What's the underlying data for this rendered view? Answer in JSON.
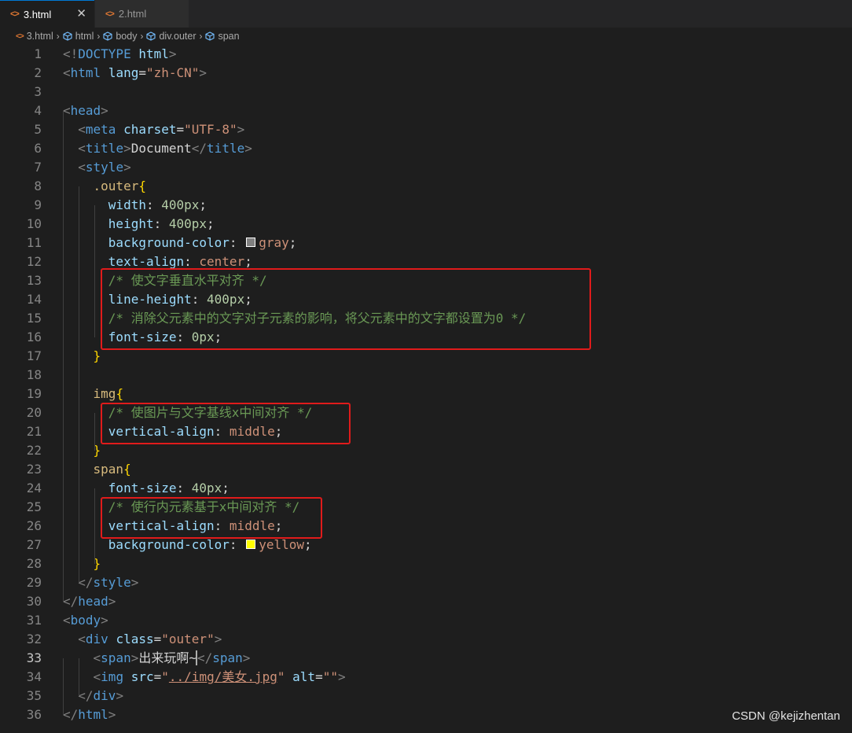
{
  "tabs": [
    {
      "label": "3.html",
      "icon": "html-code-icon",
      "active": true,
      "close": "✕"
    },
    {
      "label": "2.html",
      "icon": "html-code-icon",
      "active": false
    }
  ],
  "breadcrumbs": [
    "3.html",
    "html",
    "body",
    "div.outer",
    "span"
  ],
  "colors": {
    "gray_swatch": "#808080",
    "yellow_swatch": "#ffff00"
  },
  "lines": [
    {
      "n": "1",
      "tokens": [
        {
          "c": "t-br",
          "t": "<!"
        },
        {
          "c": "t-tag",
          "t": "DOCTYPE"
        },
        {
          "c": "t-txt",
          "t": " "
        },
        {
          "c": "t-attr",
          "t": "html"
        },
        {
          "c": "t-br",
          "t": ">"
        }
      ]
    },
    {
      "n": "2",
      "tokens": [
        {
          "c": "t-br",
          "t": "<"
        },
        {
          "c": "t-tag",
          "t": "html"
        },
        {
          "c": "t-txt",
          "t": " "
        },
        {
          "c": "t-attr",
          "t": "lang"
        },
        {
          "c": "t-txt",
          "t": "="
        },
        {
          "c": "t-str",
          "t": "\"zh-CN\""
        },
        {
          "c": "t-br",
          "t": ">"
        }
      ]
    },
    {
      "n": "3",
      "tokens": []
    },
    {
      "n": "4",
      "tokens": [
        {
          "c": "t-br",
          "t": "<"
        },
        {
          "c": "t-tag",
          "t": "head"
        },
        {
          "c": "t-br",
          "t": ">"
        }
      ]
    },
    {
      "n": "5",
      "tokens": [
        {
          "c": "t-txt",
          "t": "  "
        },
        {
          "c": "t-br",
          "t": "<"
        },
        {
          "c": "t-tag",
          "t": "meta"
        },
        {
          "c": "t-txt",
          "t": " "
        },
        {
          "c": "t-attr",
          "t": "charset"
        },
        {
          "c": "t-txt",
          "t": "="
        },
        {
          "c": "t-str",
          "t": "\"UTF-8\""
        },
        {
          "c": "t-br",
          "t": ">"
        }
      ]
    },
    {
      "n": "6",
      "tokens": [
        {
          "c": "t-txt",
          "t": "  "
        },
        {
          "c": "t-br",
          "t": "<"
        },
        {
          "c": "t-tag",
          "t": "title"
        },
        {
          "c": "t-br",
          "t": ">"
        },
        {
          "c": "t-txt",
          "t": "Document"
        },
        {
          "c": "t-br",
          "t": "</"
        },
        {
          "c": "t-tag",
          "t": "title"
        },
        {
          "c": "t-br",
          "t": ">"
        }
      ]
    },
    {
      "n": "7",
      "tokens": [
        {
          "c": "t-txt",
          "t": "  "
        },
        {
          "c": "t-br",
          "t": "<"
        },
        {
          "c": "t-tag",
          "t": "style"
        },
        {
          "c": "t-br",
          "t": ">"
        }
      ]
    },
    {
      "n": "8",
      "tokens": [
        {
          "c": "t-txt",
          "t": "    "
        },
        {
          "c": "t-sel",
          "t": ".outer"
        },
        {
          "c": "t-brace",
          "t": "{"
        }
      ]
    },
    {
      "n": "9",
      "tokens": [
        {
          "c": "t-txt",
          "t": "      "
        },
        {
          "c": "t-prop",
          "t": "width"
        },
        {
          "c": "t-txt",
          "t": ": "
        },
        {
          "c": "t-num",
          "t": "400px"
        },
        {
          "c": "t-txt",
          "t": ";"
        }
      ]
    },
    {
      "n": "10",
      "tokens": [
        {
          "c": "t-txt",
          "t": "      "
        },
        {
          "c": "t-prop",
          "t": "height"
        },
        {
          "c": "t-txt",
          "t": ": "
        },
        {
          "c": "t-num",
          "t": "400px"
        },
        {
          "c": "t-txt",
          "t": ";"
        }
      ]
    },
    {
      "n": "11",
      "tokens": [
        {
          "c": "t-txt",
          "t": "      "
        },
        {
          "c": "t-prop",
          "t": "background-color"
        },
        {
          "c": "t-txt",
          "t": ": "
        },
        {
          "swatch": "gray_swatch"
        },
        {
          "c": "t-val",
          "t": "gray"
        },
        {
          "c": "t-txt",
          "t": ";"
        }
      ]
    },
    {
      "n": "12",
      "tokens": [
        {
          "c": "t-txt",
          "t": "      "
        },
        {
          "c": "t-prop",
          "t": "text-align"
        },
        {
          "c": "t-txt",
          "t": ": "
        },
        {
          "c": "t-val",
          "t": "center"
        },
        {
          "c": "t-txt",
          "t": ";"
        }
      ]
    },
    {
      "n": "13",
      "tokens": [
        {
          "c": "t-txt",
          "t": "      "
        },
        {
          "c": "t-com",
          "t": "/* 使文字垂直水平对齐 */"
        }
      ]
    },
    {
      "n": "14",
      "tokens": [
        {
          "c": "t-txt",
          "t": "      "
        },
        {
          "c": "t-prop",
          "t": "line-height"
        },
        {
          "c": "t-txt",
          "t": ": "
        },
        {
          "c": "t-num",
          "t": "400px"
        },
        {
          "c": "t-txt",
          "t": ";"
        }
      ]
    },
    {
      "n": "15",
      "tokens": [
        {
          "c": "t-txt",
          "t": "      "
        },
        {
          "c": "t-com",
          "t": "/* 消除父元素中的文字对子元素的影响，将父元素中的文字都设置为0 */"
        }
      ]
    },
    {
      "n": "16",
      "tokens": [
        {
          "c": "t-txt",
          "t": "      "
        },
        {
          "c": "t-prop",
          "t": "font-size"
        },
        {
          "c": "t-txt",
          "t": ": "
        },
        {
          "c": "t-num",
          "t": "0px"
        },
        {
          "c": "t-txt",
          "t": ";"
        }
      ]
    },
    {
      "n": "17",
      "tokens": [
        {
          "c": "t-txt",
          "t": "    "
        },
        {
          "c": "t-brace",
          "t": "}"
        }
      ]
    },
    {
      "n": "18",
      "tokens": []
    },
    {
      "n": "19",
      "tokens": [
        {
          "c": "t-txt",
          "t": "    "
        },
        {
          "c": "t-sel",
          "t": "img"
        },
        {
          "c": "t-brace",
          "t": "{"
        }
      ]
    },
    {
      "n": "20",
      "tokens": [
        {
          "c": "t-txt",
          "t": "      "
        },
        {
          "c": "t-com",
          "t": "/* 使图片与文字基线x中间对齐 */"
        }
      ]
    },
    {
      "n": "21",
      "tokens": [
        {
          "c": "t-txt",
          "t": "      "
        },
        {
          "c": "t-prop",
          "t": "vertical-align"
        },
        {
          "c": "t-txt",
          "t": ": "
        },
        {
          "c": "t-val",
          "t": "middle"
        },
        {
          "c": "t-txt",
          "t": ";"
        }
      ]
    },
    {
      "n": "22",
      "tokens": [
        {
          "c": "t-txt",
          "t": "    "
        },
        {
          "c": "t-brace",
          "t": "}"
        }
      ]
    },
    {
      "n": "23",
      "tokens": [
        {
          "c": "t-txt",
          "t": "    "
        },
        {
          "c": "t-sel",
          "t": "span"
        },
        {
          "c": "t-brace",
          "t": "{"
        }
      ]
    },
    {
      "n": "24",
      "tokens": [
        {
          "c": "t-txt",
          "t": "      "
        },
        {
          "c": "t-prop",
          "t": "font-size"
        },
        {
          "c": "t-txt",
          "t": ": "
        },
        {
          "c": "t-num",
          "t": "40px"
        },
        {
          "c": "t-txt",
          "t": ";"
        }
      ]
    },
    {
      "n": "25",
      "tokens": [
        {
          "c": "t-txt",
          "t": "      "
        },
        {
          "c": "t-com",
          "t": "/* 使行内元素基于x中间对齐 */"
        }
      ]
    },
    {
      "n": "26",
      "tokens": [
        {
          "c": "t-txt",
          "t": "      "
        },
        {
          "c": "t-prop",
          "t": "vertical-align"
        },
        {
          "c": "t-txt",
          "t": ": "
        },
        {
          "c": "t-val",
          "t": "middle"
        },
        {
          "c": "t-txt",
          "t": ";"
        }
      ]
    },
    {
      "n": "27",
      "tokens": [
        {
          "c": "t-txt",
          "t": "      "
        },
        {
          "c": "t-prop",
          "t": "background-color"
        },
        {
          "c": "t-txt",
          "t": ": "
        },
        {
          "swatch": "yellow_swatch"
        },
        {
          "c": "t-val",
          "t": "yellow"
        },
        {
          "c": "t-txt",
          "t": ";"
        }
      ]
    },
    {
      "n": "28",
      "tokens": [
        {
          "c": "t-txt",
          "t": "    "
        },
        {
          "c": "t-brace",
          "t": "}"
        }
      ]
    },
    {
      "n": "29",
      "tokens": [
        {
          "c": "t-txt",
          "t": "  "
        },
        {
          "c": "t-br",
          "t": "</"
        },
        {
          "c": "t-tag",
          "t": "style"
        },
        {
          "c": "t-br",
          "t": ">"
        }
      ]
    },
    {
      "n": "30",
      "tokens": [
        {
          "c": "t-br",
          "t": "</"
        },
        {
          "c": "t-tag",
          "t": "head"
        },
        {
          "c": "t-br",
          "t": ">"
        }
      ]
    },
    {
      "n": "31",
      "tokens": [
        {
          "c": "t-br",
          "t": "<"
        },
        {
          "c": "t-tag",
          "t": "body"
        },
        {
          "c": "t-br",
          "t": ">"
        }
      ]
    },
    {
      "n": "32",
      "tokens": [
        {
          "c": "t-txt",
          "t": "  "
        },
        {
          "c": "t-br",
          "t": "<"
        },
        {
          "c": "t-tag",
          "t": "div"
        },
        {
          "c": "t-txt",
          "t": " "
        },
        {
          "c": "t-attr",
          "t": "class"
        },
        {
          "c": "t-txt",
          "t": "="
        },
        {
          "c": "t-str",
          "t": "\"outer\""
        },
        {
          "c": "t-br",
          "t": ">"
        }
      ]
    },
    {
      "n": "33",
      "current": true,
      "tokens": [
        {
          "c": "t-txt",
          "t": "    "
        },
        {
          "c": "t-br",
          "t": "<"
        },
        {
          "c": "t-tag",
          "t": "span"
        },
        {
          "c": "t-br",
          "t": ">"
        },
        {
          "c": "t-txt",
          "t": "出来玩啊~"
        },
        {
          "cursor": true
        },
        {
          "c": "t-br",
          "t": "</"
        },
        {
          "c": "t-tag",
          "t": "span"
        },
        {
          "c": "t-br",
          "t": ">"
        }
      ]
    },
    {
      "n": "34",
      "tokens": [
        {
          "c": "t-txt",
          "t": "    "
        },
        {
          "c": "t-br",
          "t": "<"
        },
        {
          "c": "t-tag",
          "t": "img"
        },
        {
          "c": "t-txt",
          "t": " "
        },
        {
          "c": "t-attr",
          "t": "src"
        },
        {
          "c": "t-txt",
          "t": "="
        },
        {
          "c": "t-str",
          "t": "\""
        },
        {
          "c": "t-str u",
          "t": "../img/美女.jpg"
        },
        {
          "c": "t-str",
          "t": "\""
        },
        {
          "c": "t-txt",
          "t": " "
        },
        {
          "c": "t-attr",
          "t": "alt"
        },
        {
          "c": "t-txt",
          "t": "="
        },
        {
          "c": "t-str",
          "t": "\"\""
        },
        {
          "c": "t-br",
          "t": ">"
        }
      ]
    },
    {
      "n": "35",
      "tokens": [
        {
          "c": "t-txt",
          "t": "  "
        },
        {
          "c": "t-br",
          "t": "</"
        },
        {
          "c": "t-tag",
          "t": "div"
        },
        {
          "c": "t-br",
          "t": ">"
        }
      ]
    },
    {
      "n": "36",
      "tokens": [
        {
          "c": "t-br",
          "t": "</"
        },
        {
          "c": "t-tag",
          "t": "html"
        },
        {
          "c": "t-br",
          "t": ">"
        }
      ]
    }
  ],
  "watermark": "CSDN @kejizhentan"
}
